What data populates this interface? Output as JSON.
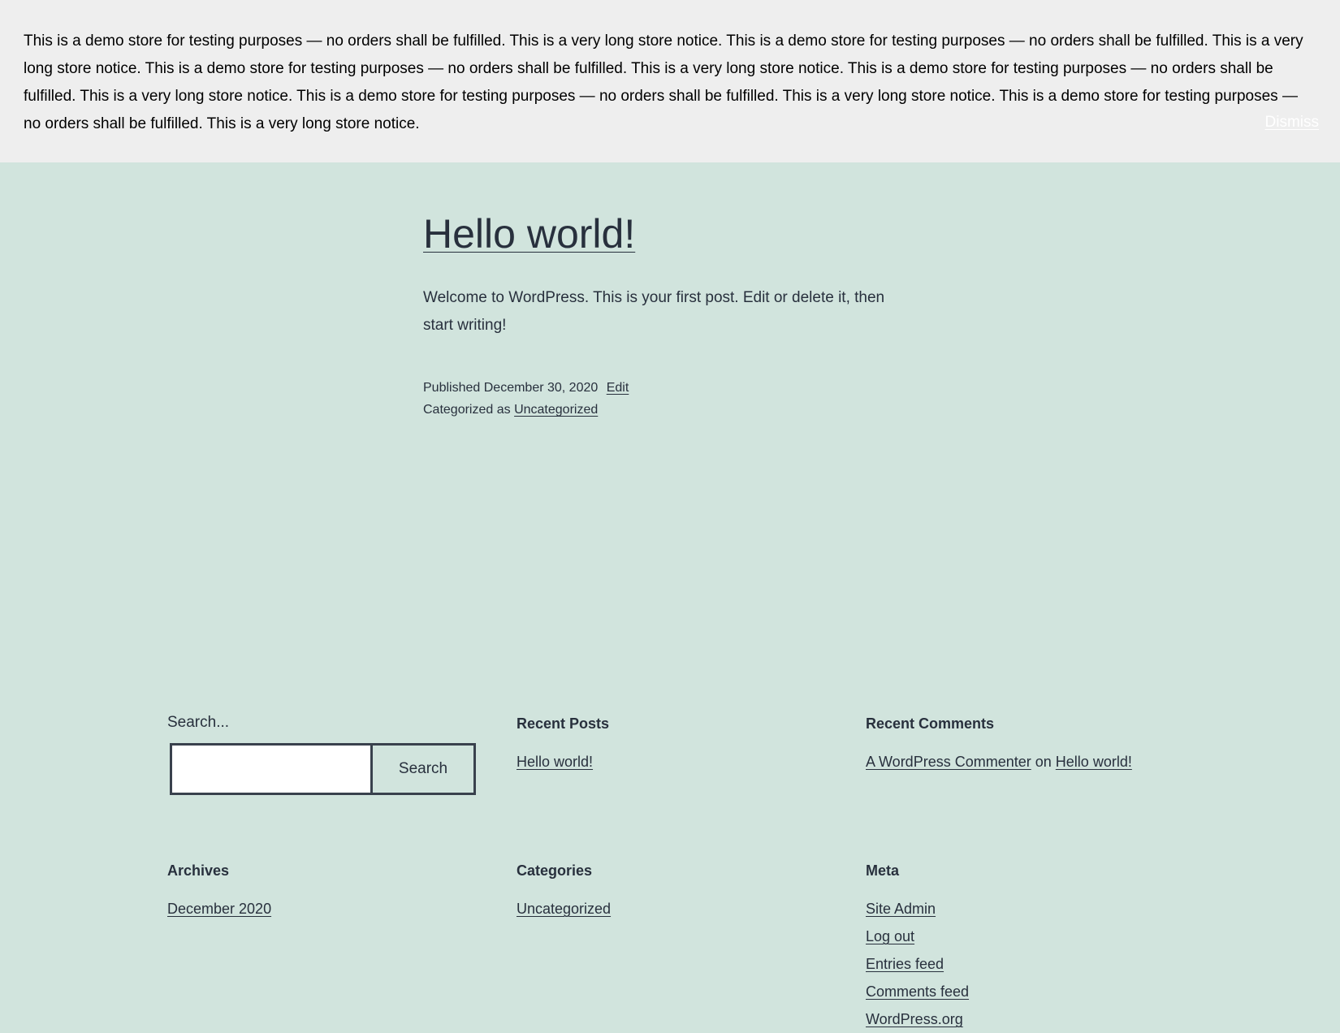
{
  "store_notice": {
    "text": "This is a demo store for testing purposes — no orders shall be fulfilled. This is a very long store notice. This is a demo store for testing purposes — no orders shall be fulfilled. This is a very long store notice. This is a demo store for testing purposes — no orders shall be fulfilled. This is a very long store notice. This is a demo store for testing purposes — no orders shall be fulfilled. This is a very long store notice. This is a demo store for testing purposes — no orders shall be fulfilled. This is a very long store notice. This is a demo store for testing purposes — no orders shall be fulfilled. This is a very long store notice.",
    "dismiss_label": "Dismiss"
  },
  "post": {
    "title": "Hello world!",
    "excerpt": "Welcome to WordPress. This is your first post. Edit or delete it, then start writing!",
    "published_prefix": "Published",
    "published_date": "December 30, 2020",
    "edit_label": "Edit",
    "categorized_prefix": "Categorized as",
    "category": "Uncategorized"
  },
  "widgets": {
    "search": {
      "label": "Search...",
      "input_value": "",
      "button_label": "Search"
    },
    "recent_posts": {
      "title": "Recent Posts",
      "items": [
        "Hello world!"
      ]
    },
    "recent_comments": {
      "title": "Recent Comments",
      "author": "A WordPress Commenter",
      "on_text": "on",
      "post": "Hello world!"
    },
    "archives": {
      "title": "Archives",
      "items": [
        "December 2020"
      ]
    },
    "categories": {
      "title": "Categories",
      "items": [
        "Uncategorized"
      ]
    },
    "meta": {
      "title": "Meta",
      "items": [
        "Site Admin",
        "Log out",
        "Entries feed",
        "Comments feed",
        "WordPress.org"
      ]
    }
  },
  "colors": {
    "page_background": "#d1e4dd",
    "notice_background": "#eeeeee",
    "text": "#28303d"
  }
}
